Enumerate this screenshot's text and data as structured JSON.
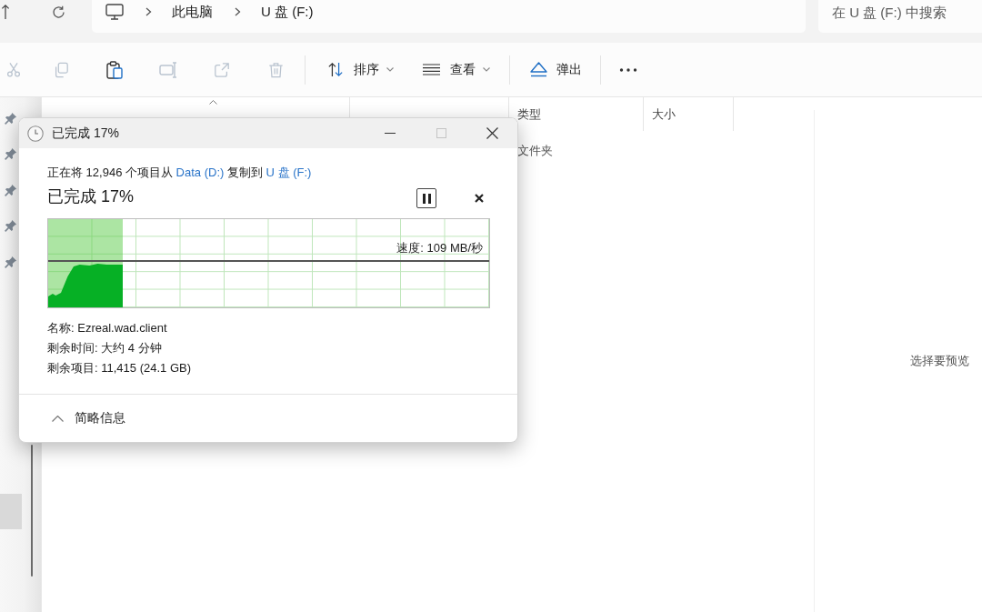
{
  "address_bar": {
    "breadcrumb": [
      {
        "label": "此电脑"
      },
      {
        "label": "U 盘 (F:)"
      }
    ],
    "search": {
      "placeholder": "在 U 盘 (F:) 中搜索"
    }
  },
  "toolbar": {
    "clipboard_actions": [
      {
        "disabled": true
      },
      {
        "disabled": true
      },
      {
        "disabled": false
      },
      {
        "disabled": true
      },
      {
        "disabled": true
      },
      {
        "disabled": true
      }
    ],
    "sort": {
      "label": "排序"
    },
    "view": {
      "label": "查看"
    },
    "eject": {
      "label": "弹出"
    }
  },
  "nav_pane": {
    "quick_access": [
      {
        "pinned": true
      },
      {
        "pinned": true
      },
      {
        "pinned": true
      },
      {
        "pinned": true
      },
      {
        "pinned": true
      }
    ],
    "drives": [
      {
        "selected": true
      }
    ]
  },
  "file_list": {
    "columns": [
      {
        "sorted": true
      },
      {
        "sorted": false
      },
      {
        "label": "类型",
        "sorted": false
      },
      {
        "label": "大小",
        "sorted": false
      }
    ],
    "rows": [
      {
        "type": "文件夹"
      }
    ]
  },
  "preview_pane": {
    "message": "选择要预览"
  },
  "copy_dialog": {
    "title_bar": {
      "title": "已完成 17%",
      "maximize_disabled": true
    },
    "description": {
      "prefix": "正在将 12,946 个项目从",
      "source": "Data (D:)",
      "middle": "复制到",
      "destination": "U 盘 (F:)"
    },
    "status": "已完成 17%",
    "paused": false,
    "progress": {
      "level": 0.17
    },
    "speed": "速度: 109 MB/秒",
    "details": [
      "名称: Ezreal.wad.client",
      "剩余时间: 大约 4 分钟",
      "剩余项目: 11,415 (24.1 GB)"
    ],
    "details_toggle": {
      "label": "简略信息",
      "expanded": true
    }
  }
}
